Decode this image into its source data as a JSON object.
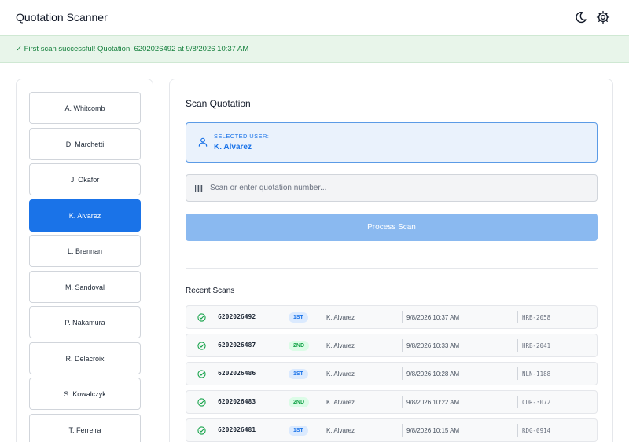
{
  "app": {
    "title": "Quotation Scanner"
  },
  "header": {
    "theme_icon": "moon-icon",
    "settings_icon": "gear-icon"
  },
  "banner": {
    "message": "✓ First scan successful! Quotation: 6202026492 at 9/8/2026 10:37 AM"
  },
  "users": [
    {
      "name": "A. Whitcomb",
      "selected": false
    },
    {
      "name": "D. Marchetti",
      "selected": false
    },
    {
      "name": "J. Okafor",
      "selected": false
    },
    {
      "name": "K. Alvarez",
      "selected": true
    },
    {
      "name": "L. Brennan",
      "selected": false
    },
    {
      "name": "M. Sandoval",
      "selected": false
    },
    {
      "name": "P. Nakamura",
      "selected": false
    },
    {
      "name": "R. Delacroix",
      "selected": false
    },
    {
      "name": "S. Kowalczyk",
      "selected": false
    },
    {
      "name": "T. Ferreira",
      "selected": false
    }
  ],
  "scan": {
    "title": "Scan Quotation",
    "selected_label": "SELECTED USER:",
    "selected_user": "K. Alvarez",
    "input_placeholder": "Scan or enter quotation number...",
    "input_value": "",
    "process_label": "Process Scan"
  },
  "recent": {
    "title": "Recent Scans",
    "rows": [
      {
        "number": "6202026492",
        "badge": "1ST",
        "badge_type": "first",
        "user": "K. Alvarez",
        "time": "9/8/2026 10:37 AM",
        "code": "HRB-2058"
      },
      {
        "number": "6202026487",
        "badge": "2ND",
        "badge_type": "second",
        "user": "K. Alvarez",
        "time": "9/8/2026 10:33 AM",
        "code": "HRB-2041"
      },
      {
        "number": "6202026486",
        "badge": "1ST",
        "badge_type": "first",
        "user": "K. Alvarez",
        "time": "9/8/2026 10:28 AM",
        "code": "NLN-1188"
      },
      {
        "number": "6202026483",
        "badge": "2ND",
        "badge_type": "second",
        "user": "K. Alvarez",
        "time": "9/8/2026 10:22 AM",
        "code": "CDR-3072"
      },
      {
        "number": "6202026481",
        "badge": "1ST",
        "badge_type": "first",
        "user": "K. Alvarez",
        "time": "9/8/2026 10:15 AM",
        "code": "RDG-0914"
      }
    ]
  },
  "colors": {
    "accent": "#1a73e8",
    "success": "#15803d",
    "banner_bg": "#e8f5ea",
    "process_disabled": "#8ab9f0"
  }
}
